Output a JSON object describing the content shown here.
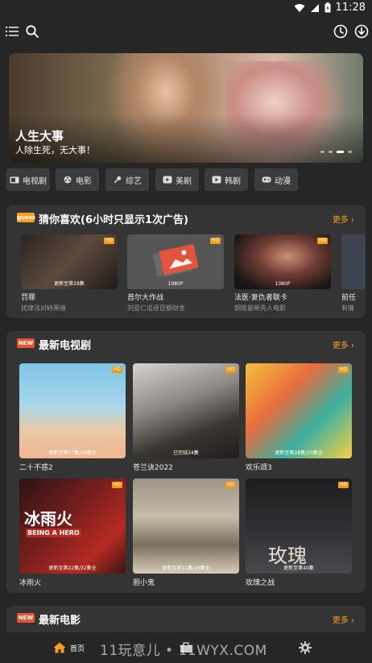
{
  "status_bar": {
    "time": "11:28"
  },
  "banner": {
    "title": "人生大事",
    "subtitle": "人除生死，无大事！"
  },
  "categories": [
    {
      "label": "电视剧",
      "icon": "tv-icon"
    },
    {
      "label": "电影",
      "icon": "film-reel-icon"
    },
    {
      "label": "综艺",
      "icon": "microphone-icon"
    },
    {
      "label": "美剧",
      "icon": "play-icon"
    },
    {
      "label": "韩剧",
      "icon": "play-icon"
    },
    {
      "label": "动漫",
      "icon": "game-controller-icon"
    }
  ],
  "guess": {
    "badge": "guess",
    "title": "猜你喜欢(6小时只显示1次广告)",
    "more": "更多 ›",
    "items": [
      {
        "name": "罚罪",
        "desc": "扰律法对峙黑暗",
        "ep": "更新至第28集",
        "hd": "HD"
      },
      {
        "name": "首尔大作战",
        "desc": "刘亚仁追逐巨额财金",
        "ep": "1080P",
        "hd": "HD"
      },
      {
        "name": "法医·复仇者联卡",
        "desc": "钢炼最新先人电影",
        "ep": "1080P",
        "hd": "HD"
      },
      {
        "name": "前任",
        "desc": "有情",
        "ep": "",
        "hd": ""
      }
    ]
  },
  "tv": {
    "badge": "NEW",
    "title": "最新电视剧",
    "more": "更多 ›",
    "items": [
      {
        "name": "二十不惑2",
        "ep": "更新至第27集/36集全",
        "hd": "HD"
      },
      {
        "name": "苍兰诀2022",
        "ep": "已完结34集",
        "hd": "HD"
      },
      {
        "name": "欢乐颂3",
        "ep": "更新至第28集/33集全",
        "hd": "HD"
      },
      {
        "name": "冰雨火",
        "ep": "更新至第22集/32集全",
        "hd": "HD",
        "poster_text": "冰雨火",
        "poster_sub": "BEING A HERO"
      },
      {
        "name": "胆小鬼",
        "ep": "更新至第11集/16集全",
        "hd": "HD"
      },
      {
        "name": "玫瑰之战",
        "ep": "更新至第40集",
        "hd": "HD",
        "poster_text": "玫瑰"
      }
    ]
  },
  "movies": {
    "badge": "NEW",
    "title": "最新电影",
    "more": "更多 ›"
  },
  "bottom_nav": {
    "home_label": "首页",
    "watermark": "11玩意儿 • 11WYX.COM"
  },
  "colors": {
    "accent": "#f5a020",
    "background": "#262626",
    "card": "#343434",
    "chip": "#3c3c3c"
  }
}
